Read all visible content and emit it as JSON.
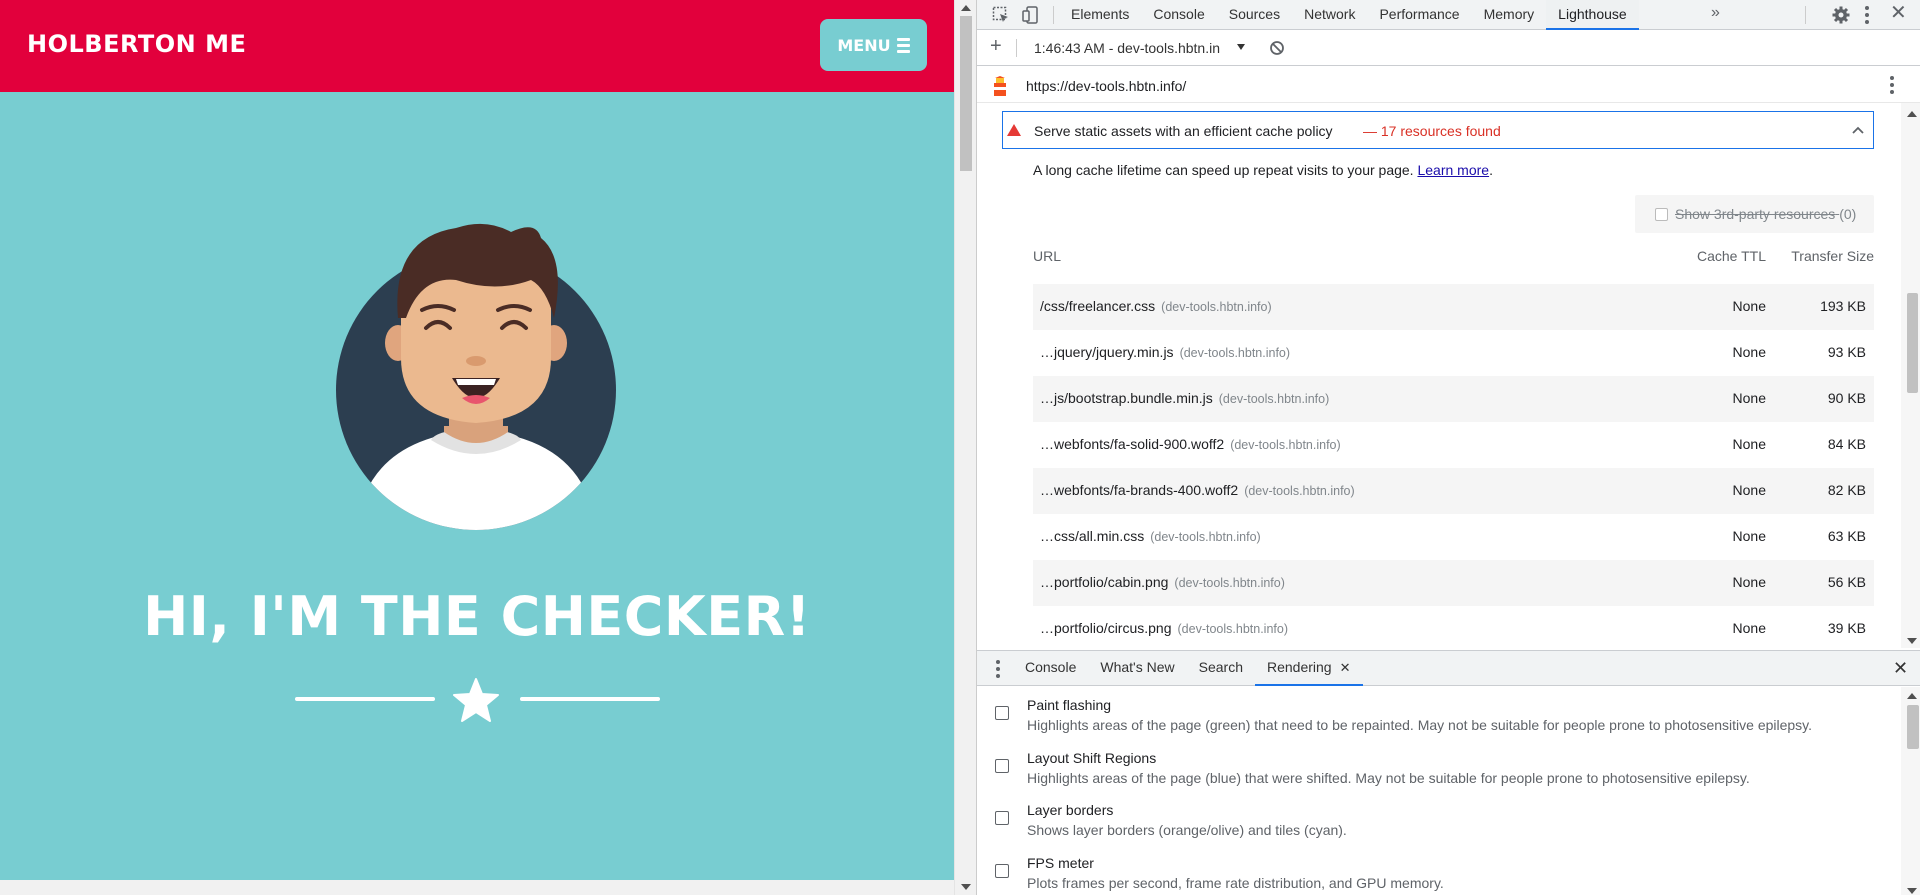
{
  "site": {
    "brand": "HOLBERTON ME",
    "menu_label": "MENU",
    "hero_title": "HI, I'M THE CHECKER!",
    "colors": {
      "nav_bg": "#e2003c",
      "page_bg": "#78cdd1",
      "text": "#ffffff"
    }
  },
  "devtools": {
    "tabs": [
      "Elements",
      "Console",
      "Sources",
      "Network",
      "Performance",
      "Memory",
      "Lighthouse"
    ],
    "active_tab": "Lighthouse",
    "toolbar": {
      "report_label": "1:46:43 AM - dev-tools.hbtn.in"
    },
    "url": "https://dev-tools.hbtn.info/",
    "audit": {
      "title": "Serve static assets with an efficient cache policy",
      "display_value": "— 17 resources found",
      "description": "A long cache lifetime can speed up repeat visits to your page.",
      "learn_more": "Learn more",
      "description_end": ".",
      "third_party_label": "Show 3rd-party resources",
      "third_party_count": "(0)",
      "columns": {
        "url": "URL",
        "ttl": "Cache TTL",
        "size": "Transfer Size"
      },
      "rows": [
        {
          "url": "/css/freelancer.css",
          "host": "(dev-tools.hbtn.info)",
          "ttl": "None",
          "size": "193 KB"
        },
        {
          "url": "…jquery/jquery.min.js",
          "host": "(dev-tools.hbtn.info)",
          "ttl": "None",
          "size": "93 KB"
        },
        {
          "url": "…js/bootstrap.bundle.min.js",
          "host": "(dev-tools.hbtn.info)",
          "ttl": "None",
          "size": "90 KB"
        },
        {
          "url": "…webfonts/fa-solid-900.woff2",
          "host": "(dev-tools.hbtn.info)",
          "ttl": "None",
          "size": "84 KB"
        },
        {
          "url": "…webfonts/fa-brands-400.woff2",
          "host": "(dev-tools.hbtn.info)",
          "ttl": "None",
          "size": "82 KB"
        },
        {
          "url": "…css/all.min.css",
          "host": "(dev-tools.hbtn.info)",
          "ttl": "None",
          "size": "63 KB"
        },
        {
          "url": "…portfolio/cabin.png",
          "host": "(dev-tools.hbtn.info)",
          "ttl": "None",
          "size": "56 KB"
        },
        {
          "url": "…portfolio/circus.png",
          "host": "(dev-tools.hbtn.info)",
          "ttl": "None",
          "size": "39 KB"
        }
      ]
    },
    "drawer": {
      "tabs": [
        "Console",
        "What's New",
        "Search",
        "Rendering"
      ],
      "active_tab": "Rendering",
      "options": [
        {
          "title": "Paint flashing",
          "desc": "Highlights areas of the page (green) that need to be repainted. May not be suitable for people prone to photosensitive epilepsy."
        },
        {
          "title": "Layout Shift Regions",
          "desc": "Highlights areas of the page (blue) that were shifted. May not be suitable for people prone to photosensitive epilepsy."
        },
        {
          "title": "Layer borders",
          "desc": "Shows layer borders (orange/olive) and tiles (cyan)."
        },
        {
          "title": "FPS meter",
          "desc": "Plots frames per second, frame rate distribution, and GPU memory."
        }
      ]
    },
    "colors": {
      "accent": "#1a73e8",
      "fail": "#d93025"
    }
  }
}
